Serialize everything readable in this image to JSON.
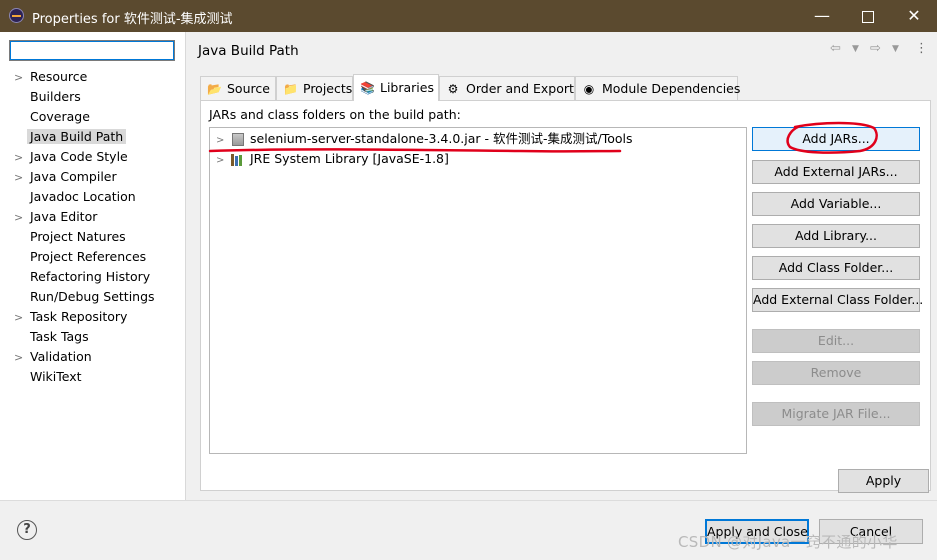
{
  "window": {
    "title": "Properties for 软件测试-集成测试",
    "minimize": "—",
    "close": "✕"
  },
  "left": {
    "filter_value": "",
    "items": [
      {
        "label": "Resource",
        "expandable": true
      },
      {
        "label": "Builders",
        "expandable": false
      },
      {
        "label": "Coverage",
        "expandable": false
      },
      {
        "label": "Java Build Path",
        "expandable": false,
        "selected": true
      },
      {
        "label": "Java Code Style",
        "expandable": true
      },
      {
        "label": "Java Compiler",
        "expandable": true
      },
      {
        "label": "Javadoc Location",
        "expandable": false
      },
      {
        "label": "Java Editor",
        "expandable": true
      },
      {
        "label": "Project Natures",
        "expandable": false
      },
      {
        "label": "Project References",
        "expandable": false
      },
      {
        "label": "Refactoring History",
        "expandable": false
      },
      {
        "label": "Run/Debug Settings",
        "expandable": false
      },
      {
        "label": "Task Repository",
        "expandable": true
      },
      {
        "label": "Task Tags",
        "expandable": false
      },
      {
        "label": "Validation",
        "expandable": true
      },
      {
        "label": "WikiText",
        "expandable": false
      }
    ]
  },
  "main": {
    "title": "Java Build Path",
    "tabs": [
      {
        "label": "Source",
        "icon": "source-folder-icon",
        "active": false
      },
      {
        "label": "Projects",
        "icon": "projects-icon",
        "active": false
      },
      {
        "label": "Libraries",
        "icon": "libraries-icon",
        "active": true
      },
      {
        "label": "Order and Export",
        "icon": "order-export-icon",
        "active": false
      },
      {
        "label": "Module Dependencies",
        "icon": "module-dependencies-icon",
        "active": false
      }
    ],
    "path_label": "JARs and class folders on the build path:",
    "tree": [
      {
        "label": "selenium-server-standalone-3.4.0.jar - 软件测试-集成测试/Tools",
        "icon": "jar-icon"
      },
      {
        "label": "JRE System Library [JavaSE-1.8]",
        "icon": "library-icon"
      }
    ],
    "buttons": {
      "add_jars": "Add JARs...",
      "add_external_jars": "Add External JARs...",
      "add_variable": "Add Variable...",
      "add_library": "Add Library...",
      "add_class_folder": "Add Class Folder...",
      "add_external_class_folder": "Add External Class Folder...",
      "edit": "Edit...",
      "remove": "Remove",
      "migrate_jar": "Migrate JAR File..."
    },
    "apply": "Apply"
  },
  "footer": {
    "help": "?",
    "apply_close": "Apply and Close",
    "cancel": "Cancel",
    "watermark": "CSDN @对Java一窍不通的小华"
  },
  "colors": {
    "titlebar": "#5b4a2f",
    "accent": "#0078d7",
    "annotation": "#e0001b"
  }
}
